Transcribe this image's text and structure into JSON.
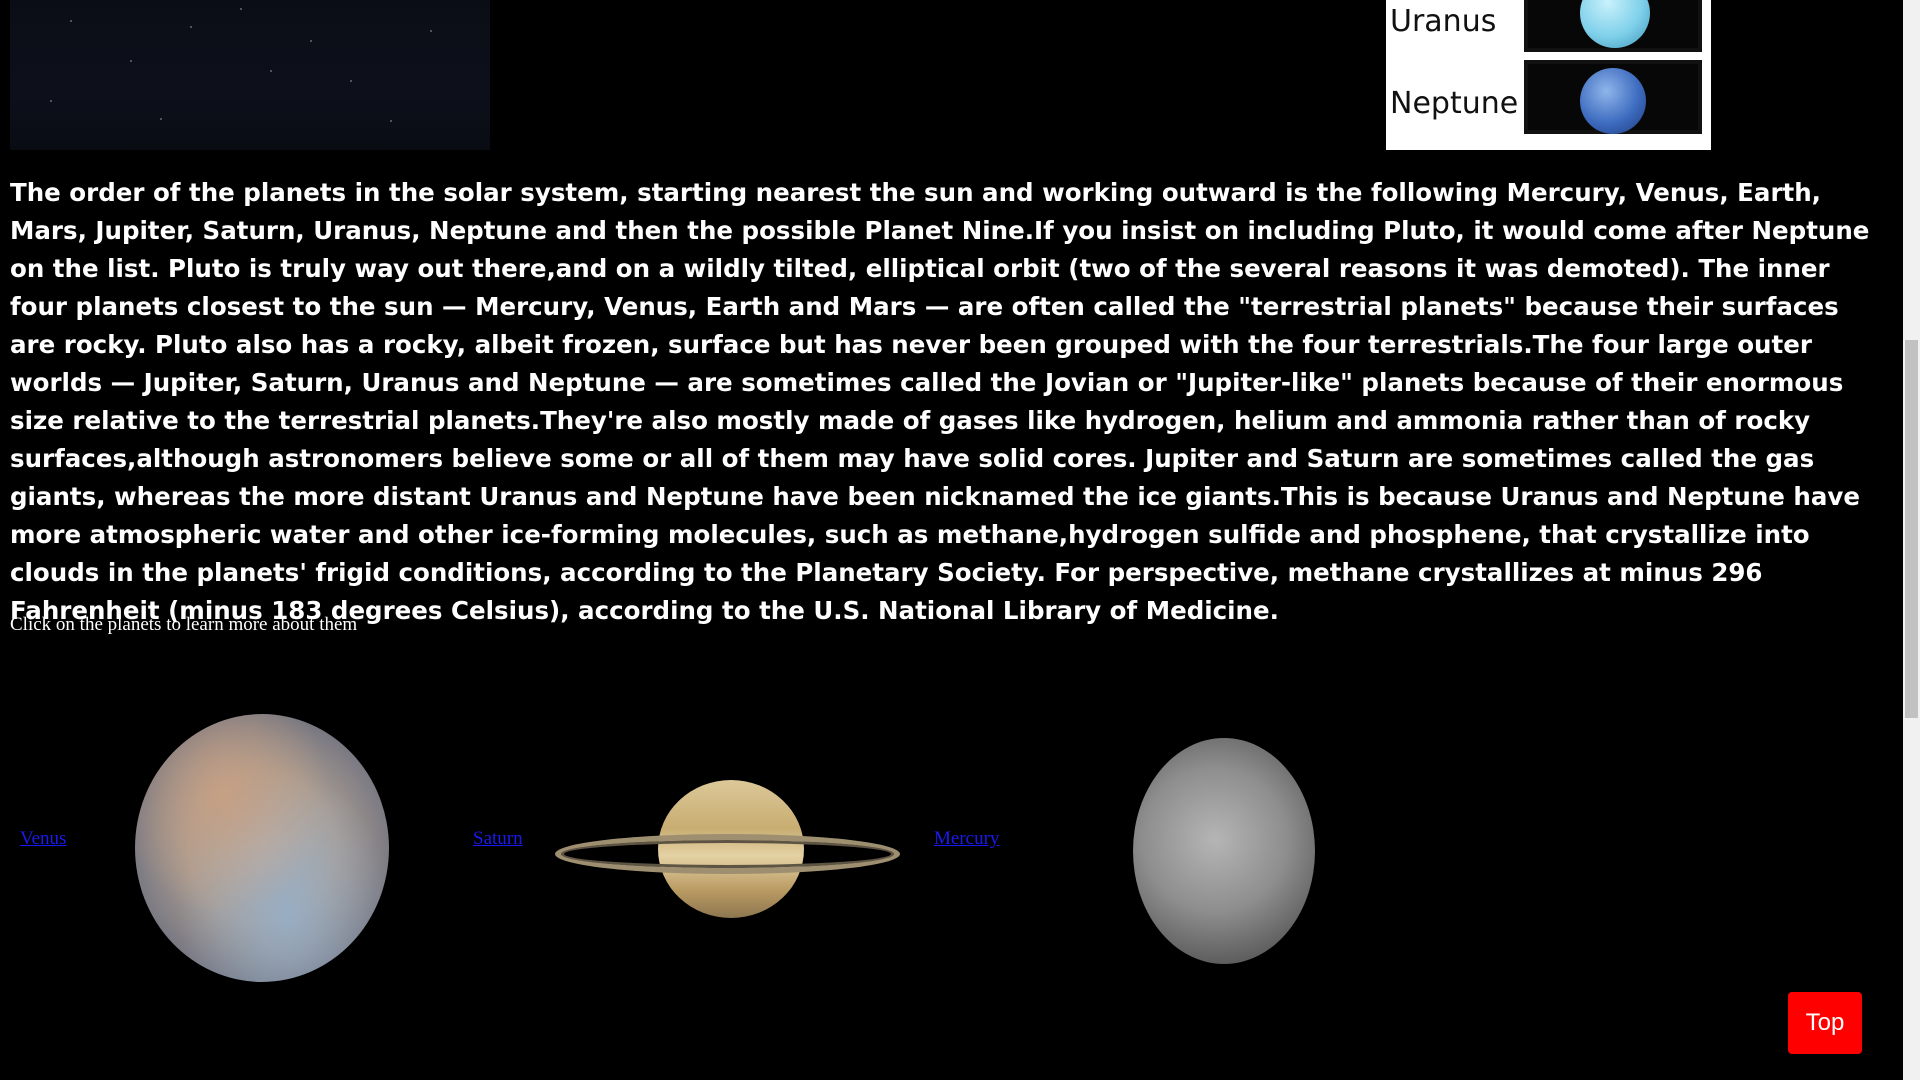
{
  "planet_table": {
    "rows": [
      {
        "label": "Uranus"
      },
      {
        "label": "Neptune"
      }
    ]
  },
  "intro": {
    "text": "The order of the planets in the solar system, starting nearest the sun and working outward is the following Mercury, Venus, Earth, Mars, Jupiter, Saturn, Uranus, Neptune and then the possible Planet Nine.If you insist on including Pluto, it would come after Neptune on the list. Pluto is truly way out there,and on a wildly tilted, elliptical orbit (two of the several reasons it was demoted). The inner four planets closest to the sun — Mercury, Venus, Earth and Mars — are often called the \"terrestrial planets\" because their surfaces are rocky. Pluto also has a rocky, albeit frozen, surface but has never been grouped with the four terrestrials.The four large outer worlds — Jupiter, Saturn, Uranus and Neptune — are sometimes called the Jovian or \"Jupiter-like\" planets because of their enormous size relative to the terrestrial planets.They're also mostly made of gases like hydrogen, helium and ammonia rather than of rocky surfaces,although astronomers believe some or all of them may have solid cores. Jupiter and Saturn are sometimes called the gas giants, whereas the more distant Uranus and Neptune have been nicknamed the ice giants.This is because Uranus and Neptune have more atmospheric water and other ice-forming molecules, such as methane,hydrogen sulfide and phosphene, that crystallize into clouds in the planets' frigid conditions, according to the Planetary Society. For perspective, methane crystallizes at minus 296 Fahrenheit (minus 183 degrees Celsius), according to the U.S. National Library of Medicine."
  },
  "hint": "Click on the planets to learn more about them",
  "planet_links": {
    "venus": "Venus",
    "saturn": "Saturn",
    "mercury": "Mercury"
  },
  "top_button": "Top",
  "colors": {
    "background": "#000000",
    "link": "#1a1aee",
    "top_button": "#ff0000"
  }
}
